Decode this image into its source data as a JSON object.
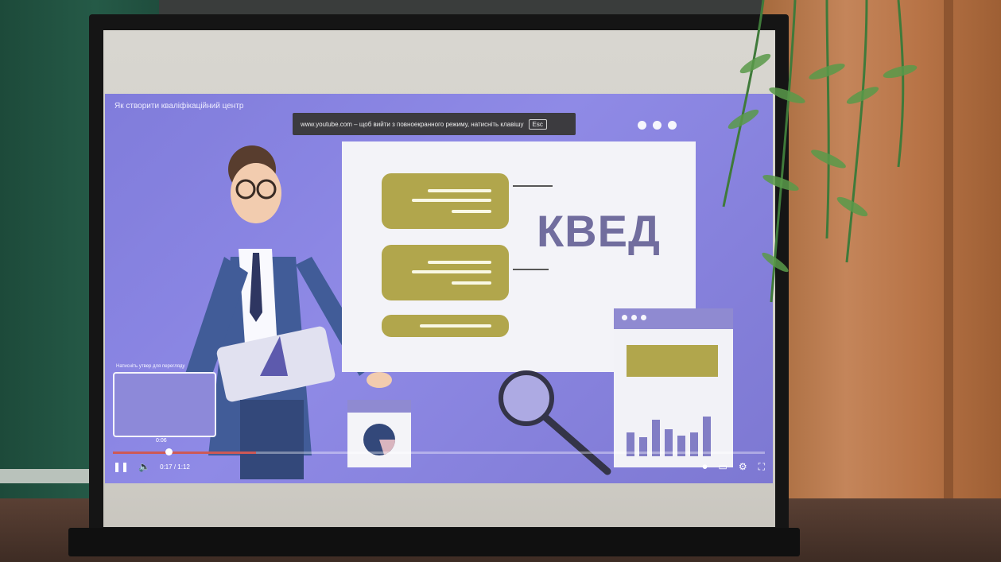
{
  "video": {
    "title": "Як створити кваліфікаційний центр",
    "fullscreen_notice": "www.youtube.com – щоб вийти з повноекранного режиму, натисніть клавішу",
    "esc_key": "Esc",
    "board_heading": "КВЕД",
    "preview_label": "Натисніть утвер для перегляду",
    "hover_time": "0:06",
    "current_time": "0:17 / 1:12",
    "progress_percent": 22
  },
  "icons": {
    "play_pause": "pause-icon",
    "volume": "volume-icon",
    "autoplay": "autoplay-toggle-icon",
    "subtitles": "subtitles-icon",
    "settings": "gear-icon",
    "fullscreen_exit": "fullscreen-exit-icon"
  },
  "colors": {
    "video_bg": "#8c86f0",
    "board": "#eeeef4",
    "accent_olive": "#b0a33c",
    "heading": "#6f6aa3",
    "progress": "#d9534f"
  }
}
